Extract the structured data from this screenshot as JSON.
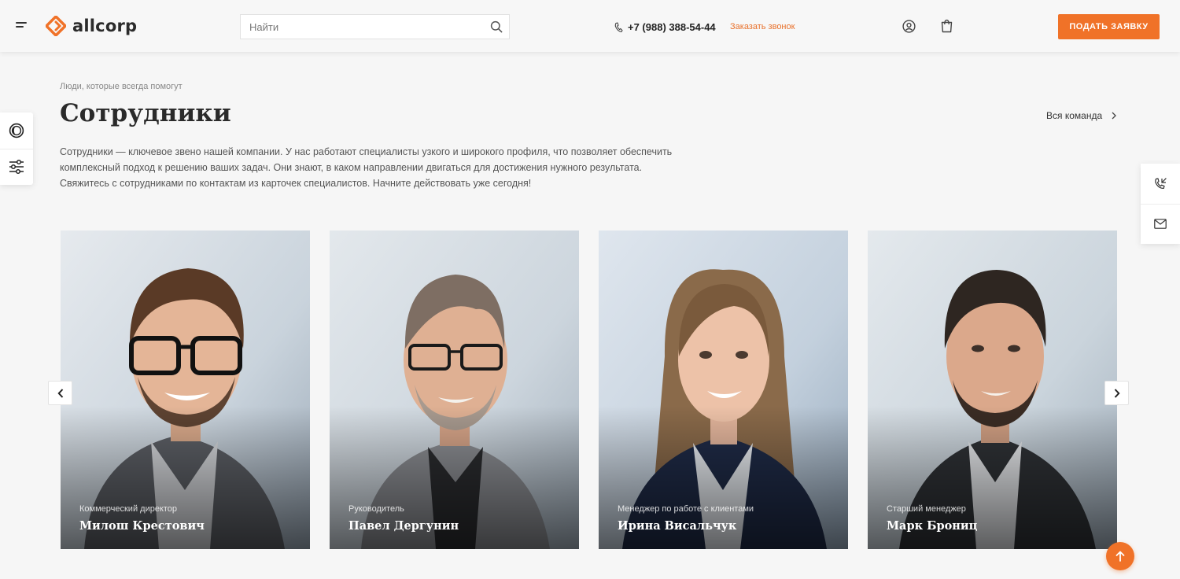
{
  "header": {
    "brand": "allcorp",
    "search_placeholder": "Найти",
    "phone": "+7 (988) 388-54-44",
    "callback_label": "Заказать звонок",
    "cta_label": "ПОДАТЬ ЗАЯВКУ"
  },
  "section": {
    "subtitle": "Люди, которые всегда помогут",
    "title": "Сотрудники",
    "all_link": "Вся команда",
    "description": "Сотрудники — ключевое звено нашей компании. У нас работают специалисты узкого и широкого профиля, что позволяет обеспечить комплексный подход к решению ваших задач. Они знают, в каком направлении двигаться для достижения нужного результата. Свяжитесь с сотрудниками по контактам из карточек специалистов. Начните действовать уже сегодня!"
  },
  "employees": [
    {
      "role": "Коммерческий директор",
      "name": "Милош Крестович"
    },
    {
      "role": "Руководитель",
      "name": "Павел Дергунин"
    },
    {
      "role": "Менеджер по работе с клиентами",
      "name": "Ирина Висальчук"
    },
    {
      "role": "Старший менеджер",
      "name": "Марк Брониц"
    }
  ],
  "colors": {
    "accent": "#f07228",
    "background": "#f6f6f6",
    "text": "#2a2a2a"
  },
  "icons": {
    "menu": "burger-menu-icon",
    "search": "search-icon",
    "phone": "phone-icon",
    "user": "user-icon",
    "cart": "cart-icon",
    "theme": "theme-toggle-icon",
    "filters": "sliders-icon",
    "callback": "phone-callback-icon",
    "mail": "mail-icon",
    "prev": "chevron-left-icon",
    "next": "chevron-right-icon",
    "top": "arrow-up-icon"
  }
}
